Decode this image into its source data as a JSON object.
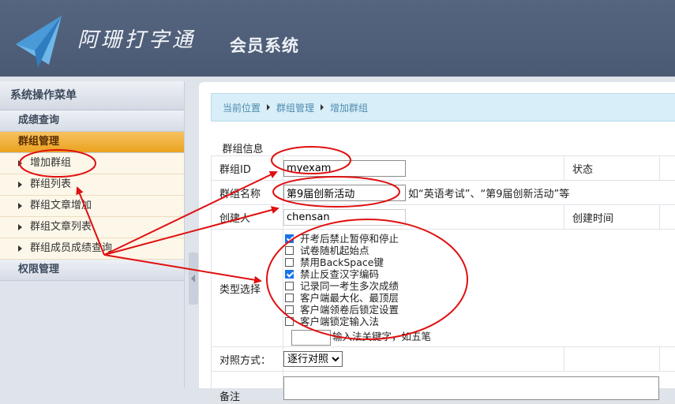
{
  "header": {
    "logo_text": "阿珊打字通",
    "system_title": "会员系统"
  },
  "sidebar": {
    "title": "系统操作菜单",
    "groups": [
      {
        "label": "成绩查询"
      },
      {
        "label": "群组管理",
        "items": [
          "增加群组",
          "群组列表",
          "群组文章增加",
          "群组文章列表",
          "群组成员成绩查询"
        ]
      },
      {
        "label": "权限管理"
      }
    ]
  },
  "breadcrumb": {
    "prefix": "当前位置",
    "level1": "群组管理",
    "level2": "增加群组"
  },
  "form": {
    "section_title": "群组信息",
    "group_id_label": "群组ID",
    "group_id_value": "myexam",
    "status_label": "状态",
    "group_name_label": "群组名称",
    "group_name_value": "第9届创新活动",
    "group_name_hint": "如“英语考试”、“第9届创新活动”等",
    "creator_label": "创建人",
    "creator_value": "chensan",
    "create_time_label": "创建时间",
    "type_label": "类型选择",
    "options": [
      {
        "label": "开考后禁止暂停和停止",
        "checked": true
      },
      {
        "label": "试卷随机起始点",
        "checked": false
      },
      {
        "label": "禁用BackSpace键",
        "checked": false
      },
      {
        "label": "禁止反查汉字编码",
        "checked": true
      },
      {
        "label": "记录同一考生多次成绩",
        "checked": false
      },
      {
        "label": "客户端最大化、最顶层",
        "checked": false
      },
      {
        "label": "客户端领卷后锁定设置",
        "checked": false
      },
      {
        "label": "客户端锁定输入法",
        "checked": false
      }
    ],
    "ime_hint": "输入法关键字，如五笔",
    "compare_label": "对照方式：",
    "compare_value": "逐行对照",
    "remark_label": "备注"
  },
  "colors": {
    "header_bg": "#4f5e78",
    "active_group": "#eaa21f",
    "annotation": "#e01010",
    "breadcrumb_bg": "#d8eef8"
  }
}
